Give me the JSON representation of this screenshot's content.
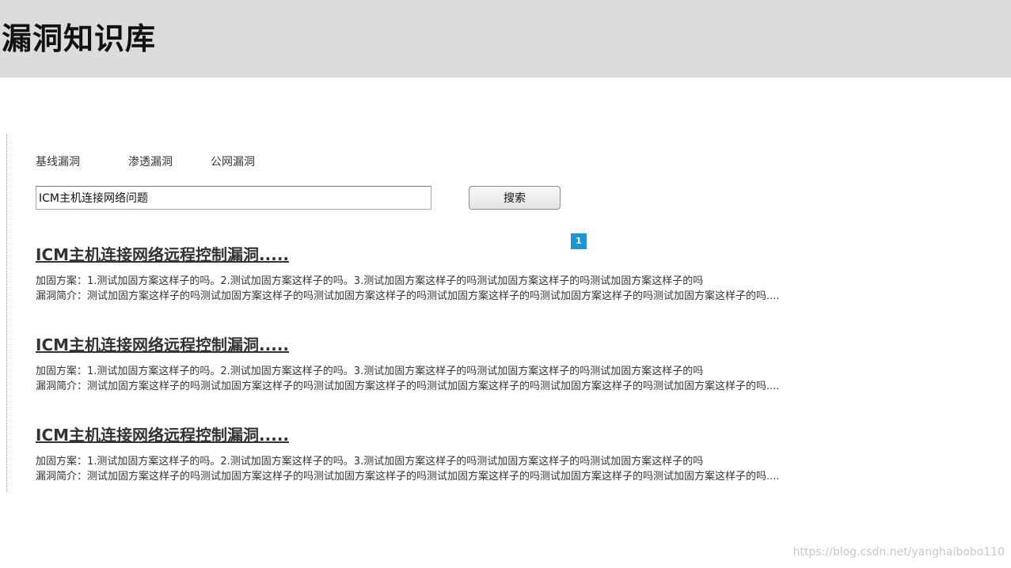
{
  "header": {
    "title": "漏洞知识库"
  },
  "tabs": [
    {
      "label": "基线漏洞"
    },
    {
      "label": "渗透漏洞"
    },
    {
      "label": "公网漏洞"
    }
  ],
  "search": {
    "value": "ICM主机连接网络问题",
    "button_label": "搜索"
  },
  "pagination": {
    "current_page": "1"
  },
  "results": [
    {
      "title": "ICM主机连接网络远程控制漏洞.....",
      "fix": "加固方案：1.测试加固方案这样子的吗。2.测试加固方案这样子的吗。3.测试加固方案这样子的吗测试加固方案这样子的吗测试加固方案这样子的吗",
      "summary": "漏洞简介：测试加固方案这样子的吗测试加固方案这样子的吗测试加固方案这样子的吗测试加固方案这样子的吗测试加固方案这样子的吗测试加固方案这样子的吗...."
    },
    {
      "title": "ICM主机连接网络远程控制漏洞.....",
      "fix": "加固方案：1.测试加固方案这样子的吗。2.测试加固方案这样子的吗。3.测试加固方案这样子的吗测试加固方案这样子的吗测试加固方案这样子的吗",
      "summary": "漏洞简介：测试加固方案这样子的吗测试加固方案这样子的吗测试加固方案这样子的吗测试加固方案这样子的吗测试加固方案这样子的吗测试加固方案这样子的吗...."
    },
    {
      "title": "ICM主机连接网络远程控制漏洞.....",
      "fix": "加固方案：1.测试加固方案这样子的吗。2.测试加固方案这样子的吗。3.测试加固方案这样子的吗测试加固方案这样子的吗测试加固方案这样子的吗",
      "summary": "漏洞简介：测试加固方案这样子的吗测试加固方案这样子的吗测试加固方案这样子的吗测试加固方案这样子的吗测试加固方案这样子的吗测试加固方案这样子的吗...."
    }
  ],
  "watermark": "https://blog.csdn.net/yanghaibobo110",
  "colors": {
    "header_bg": "#dcdcdc",
    "badge_bg": "#1a96d4",
    "text": "#333333"
  }
}
